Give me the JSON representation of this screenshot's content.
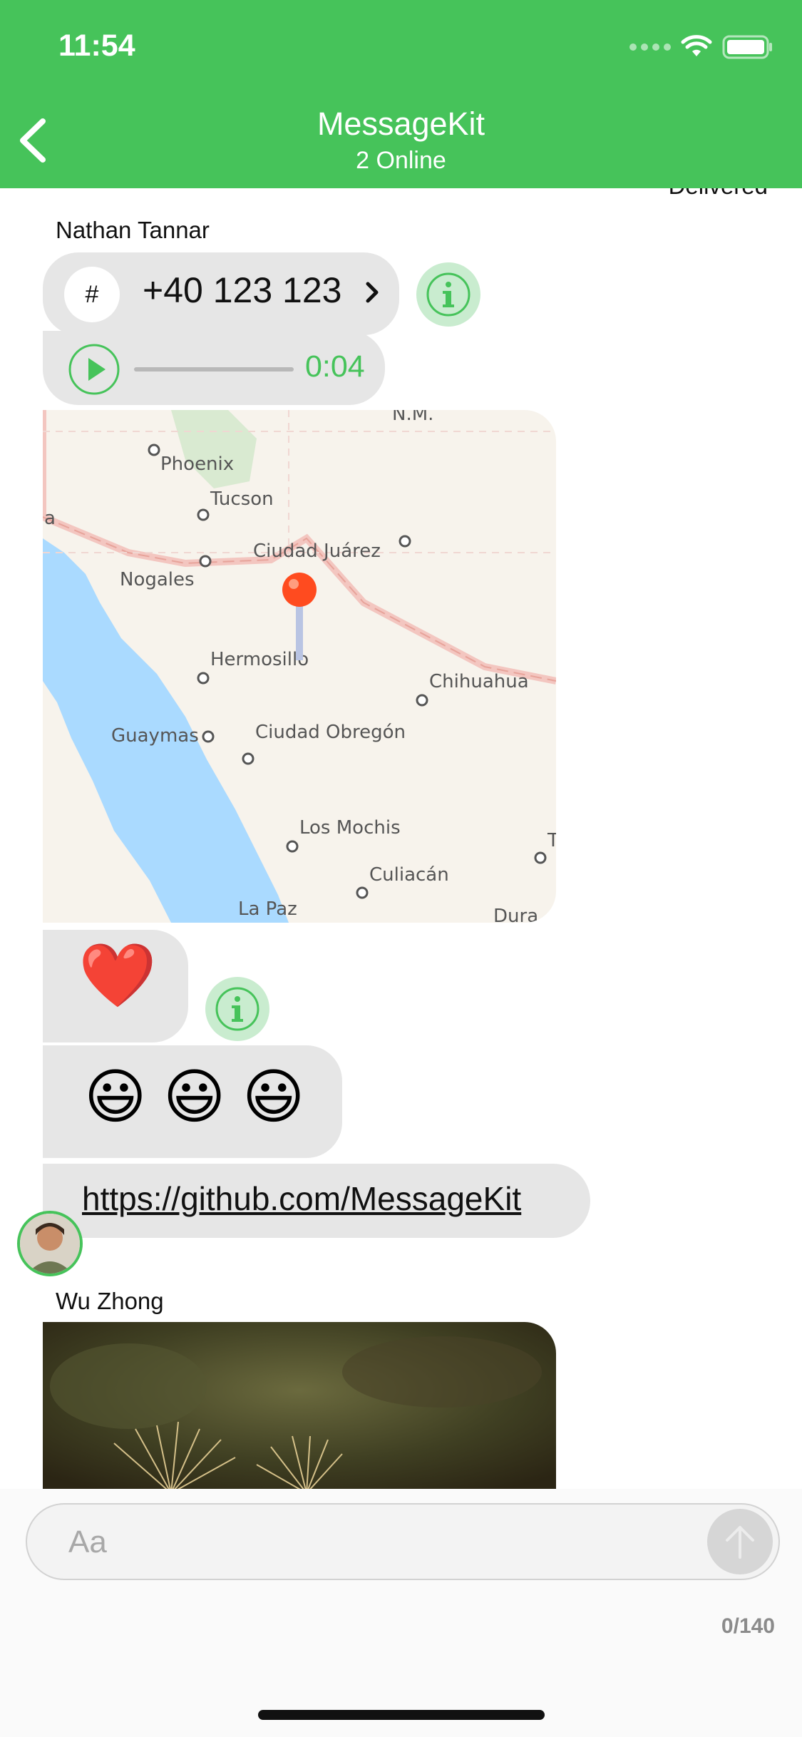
{
  "status_bar": {
    "time": "11:54"
  },
  "nav": {
    "title": "MessageKit",
    "subtitle": "2 Online"
  },
  "messages": {
    "delivered": "Delivered",
    "sender1": "Nathan Tannar",
    "contact_icon_text": "#",
    "phone_number": "+40 123 123",
    "audio_duration": "0:04",
    "map_labels": [
      "N.M.",
      "Phoenix",
      "Tucson",
      "Ciudad Juárez",
      "Nogales",
      "Hermosillo",
      "Chihuahua",
      "Guaymas",
      "Ciudad Obregón",
      "Los Mochis",
      "Culiacán",
      "La Paz",
      "Dura",
      "a",
      "T"
    ],
    "emoji_heart": "❤️",
    "emoji_smiles": "😃 😃 😃",
    "link": "https://github.com/MessageKit",
    "sender2": "Wu Zhong"
  },
  "input": {
    "placeholder": "Aa",
    "char_count": "0/140"
  },
  "colors": {
    "accent": "#46c35a",
    "bubble": "#e6e6e6",
    "info_bg": "#c9eccf"
  },
  "icons": [
    "back-chevron-icon",
    "wifi-icon",
    "battery-icon",
    "cellular-signal-icon",
    "info-icon",
    "play-icon",
    "chevron-right-icon",
    "send-arrow-icon",
    "map-pin-icon"
  ]
}
